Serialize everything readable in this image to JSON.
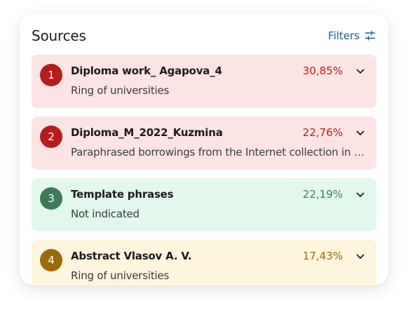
{
  "header": {
    "title": "Sources",
    "filters_label": "Filters",
    "filters_icon": "sliders-icon"
  },
  "colors": {
    "red_bg": "#fde4e4",
    "red_accent": "#b71c1c",
    "green_bg": "#e3f8ec",
    "green_accent": "#3d7a5a",
    "yellow_bg": "#fdf5dc",
    "yellow_accent": "#9a6a0d",
    "link": "#1f5f86"
  },
  "sources": [
    {
      "index": "1",
      "name": "Diploma work_ Agapova_4",
      "percent": "30,85%",
      "description": "Ring of universities",
      "theme": "red",
      "chevron_icon": "chevron-down-icon"
    },
    {
      "index": "2",
      "name": "Diploma_M_2022_Kuzmina",
      "percent": "22,76%",
      "description": "Paraphrased borrowings from the Internet collection in t…",
      "theme": "red",
      "chevron_icon": "chevron-down-icon"
    },
    {
      "index": "3",
      "name": "Template phrases",
      "percent": "22,19%",
      "description": "Not indicated",
      "theme": "green",
      "chevron_icon": "chevron-down-icon"
    },
    {
      "index": "4",
      "name": "Abstract Vlasov A. V.",
      "percent": "17,43%",
      "description": "Ring of universities",
      "theme": "yellow",
      "chevron_icon": "chevron-down-icon"
    }
  ]
}
